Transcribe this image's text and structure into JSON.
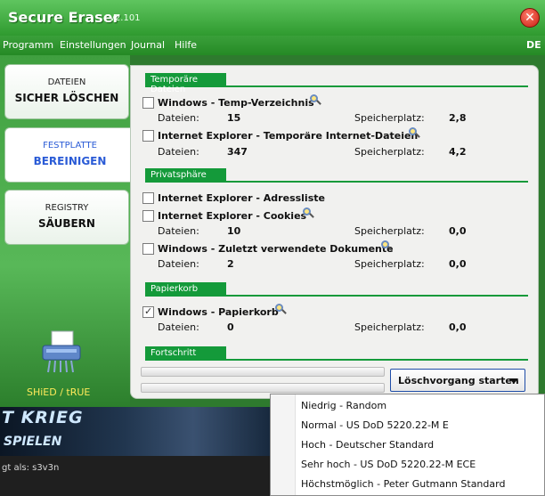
{
  "app": {
    "title": "Secure Eraser",
    "version": "v2.101",
    "close_icon": "close-icon",
    "language": "DE"
  },
  "menu": [
    "Programm",
    "Einstellungen",
    "Journal",
    "Hilfe"
  ],
  "nav": [
    {
      "line1": "DATEIEN",
      "line2": "SICHER LÖSCHEN"
    },
    {
      "line1": "FESTPLATTE",
      "line2": "BEREINIGEN"
    },
    {
      "line1": "REGISTRY",
      "line2": "SÄUBERN"
    }
  ],
  "brand": "SHiED / tRUE",
  "sections": {
    "temp": "Temporäre Dateien",
    "privacy": "Privatsphäre",
    "trash": "Papierkorb",
    "progress": "Fortschritt"
  },
  "labels": {
    "files": "Dateien:",
    "storage": "Speicherplatz:"
  },
  "items": [
    {
      "label": "Windows - Temp-Verzeichnis",
      "checked": false,
      "files": "15",
      "storage": "2,8"
    },
    {
      "label": "Internet Explorer - Temporäre Internet-Dateien",
      "checked": false,
      "files": "347",
      "storage": "4,2"
    },
    {
      "label": "Internet Explorer - Adressliste",
      "checked": false
    },
    {
      "label": "Internet Explorer - Cookies",
      "checked": false,
      "files": "10",
      "storage": "0,0"
    },
    {
      "label": "Windows - Zuletzt verwendete Dokumente",
      "checked": false,
      "files": "2",
      "storage": "0,0"
    },
    {
      "label": "Windows - Papierkorb",
      "checked": true,
      "files": "0",
      "storage": "0,0"
    }
  ],
  "start_button": "Löschvorgang starten",
  "dropdown": [
    "Niedrig - Random",
    "Normal - US DoD 5220.22-M E",
    "Hoch - Deutscher Standard",
    "Sehr hoch - US DoD 5220.22-M ECE",
    "Höchstmöglich - Peter Gutmann Standard"
  ],
  "banner": {
    "line1": "T KRIEG",
    "line2": "SPIELEN"
  },
  "status": "gt als: s3v3n"
}
